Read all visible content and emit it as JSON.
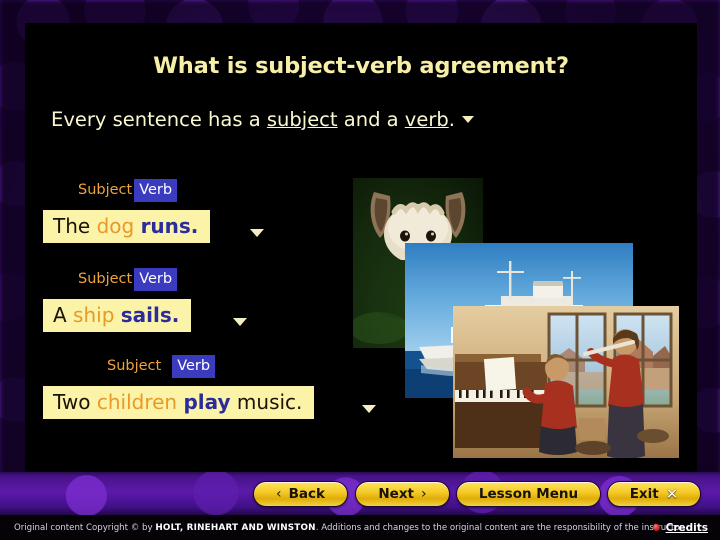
{
  "slide": {
    "title": "What is subject-verb agreement?",
    "intro": {
      "part1": "Every sentence has a ",
      "underline1": "subject",
      "part2": " and a ",
      "underline2": "verb",
      "part3": "."
    }
  },
  "labels": {
    "subject": "Subject",
    "verb": "Verb"
  },
  "examples": [
    {
      "subject_label": "Subject",
      "verb_label": "Verb",
      "lead": "The ",
      "subject_word": "dog",
      "gap1": " ",
      "verb_word": "runs.",
      "tail": ""
    },
    {
      "subject_label": "Subject",
      "verb_label": "Verb",
      "lead": "A ",
      "subject_word": "ship",
      "gap1": " ",
      "verb_word": "sails.",
      "tail": ""
    },
    {
      "subject_label": "Subject",
      "verb_label": "Verb",
      "lead": "Two ",
      "subject_word": "children",
      "gap1": " ",
      "verb_word": "play",
      "tail": " music."
    }
  ],
  "photos": {
    "dog": "dog-photo",
    "ship": "cruise-ship-photo",
    "kids": "children-playing-music-photo"
  },
  "nav": {
    "back": "Back",
    "next": "Next",
    "lesson_menu": "Lesson Menu",
    "exit": "Exit",
    "back_chevron": "‹",
    "next_chevron": "›",
    "exit_x": "✕"
  },
  "footer": {
    "copyright_pre": "Original content Copyright © by ",
    "publisher": "HOLT, RINEHART AND WINSTON",
    "copyright_post": ". Additions and changes to the original content are the responsibility of the instructor.",
    "credits": "Credits"
  },
  "colors": {
    "title_yellow": "#f7efa8",
    "body_cream": "#fbf8d0",
    "subject_orange": "#e8992a",
    "verb_blue": "#2b2b9c",
    "verb_badge_bg": "#3b3bbf",
    "sentence_bg": "#fbf3a8",
    "panel_bg": "#000000",
    "nav_gold": "#f6cc2a",
    "background_purple": "#5c1aa8",
    "credits_red": "#d42020"
  }
}
